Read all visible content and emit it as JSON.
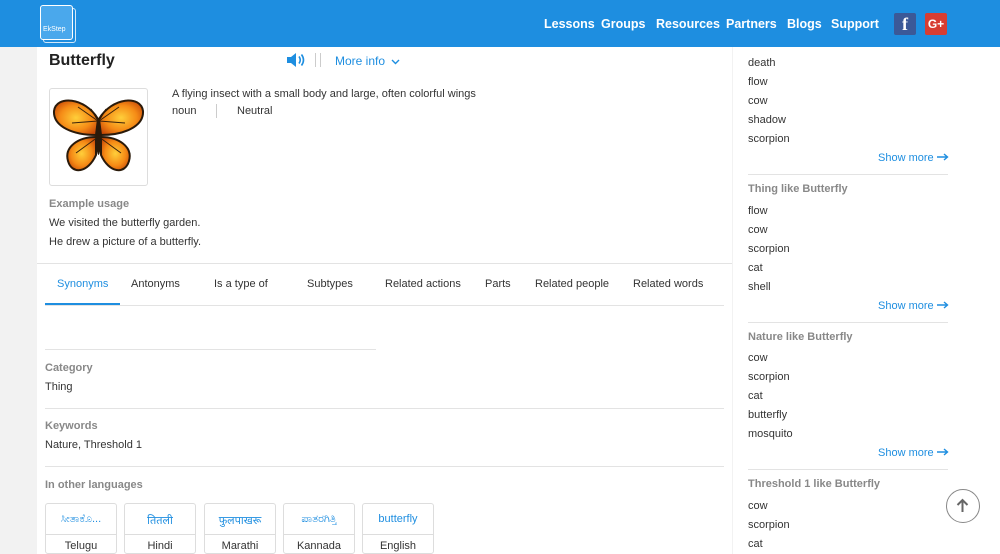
{
  "header": {
    "logo_text": "EkStep",
    "nav": [
      "Lessons",
      "Groups",
      "Resources",
      "Partners",
      "Blogs",
      "Support"
    ],
    "facebook_glyph": "f",
    "gplus_glyph": "G+"
  },
  "word": {
    "title": "Butterfly",
    "more_info": "More info",
    "meaning": "A flying insect with a small body and large, often colorful wings",
    "pos": "noun",
    "gender": "Neutral",
    "example_label": "Example usage",
    "examples": [
      "We visited the butterfly garden.",
      "He drew a picture of a butterfly."
    ]
  },
  "tabs": [
    "Synonyms",
    "Antonyms",
    "Is a type of",
    "Subtypes",
    "Related actions",
    "Parts",
    "Related people",
    "Related words"
  ],
  "category": {
    "label": "Category",
    "value": "Thing"
  },
  "keywords": {
    "label": "Keywords",
    "value": "Nature, Threshold 1"
  },
  "languages": {
    "label": "In other languages",
    "items": [
      {
        "word": "ಸೀತಾಕೊ...",
        "language": "Telugu"
      },
      {
        "word": "तितली",
        "language": "Hindi"
      },
      {
        "word": "फुलपाखरू",
        "language": "Marathi"
      },
      {
        "word": "ಪಾತರಗಿತ್ತಿ",
        "language": "Kannada"
      },
      {
        "word": "butterfly",
        "language": "English"
      }
    ]
  },
  "sidebar": {
    "top_items": [
      "death",
      "flow",
      "cow",
      "shadow",
      "scorpion"
    ],
    "show_more": "Show more",
    "groups": [
      {
        "title": "Thing like Butterfly",
        "items": [
          "flow",
          "cow",
          "scorpion",
          "cat",
          "shell"
        ]
      },
      {
        "title": "Nature like Butterfly",
        "items": [
          "cow",
          "scorpion",
          "cat",
          "butterfly",
          "mosquito"
        ]
      },
      {
        "title": "Threshold 1 like Butterfly",
        "items": [
          "cow",
          "scorpion",
          "cat"
        ]
      }
    ]
  },
  "colors": {
    "accent": "#1e8ee0",
    "header": "#1e8ee0",
    "facebook": "#3b5998",
    "gplus": "#d73d32"
  }
}
